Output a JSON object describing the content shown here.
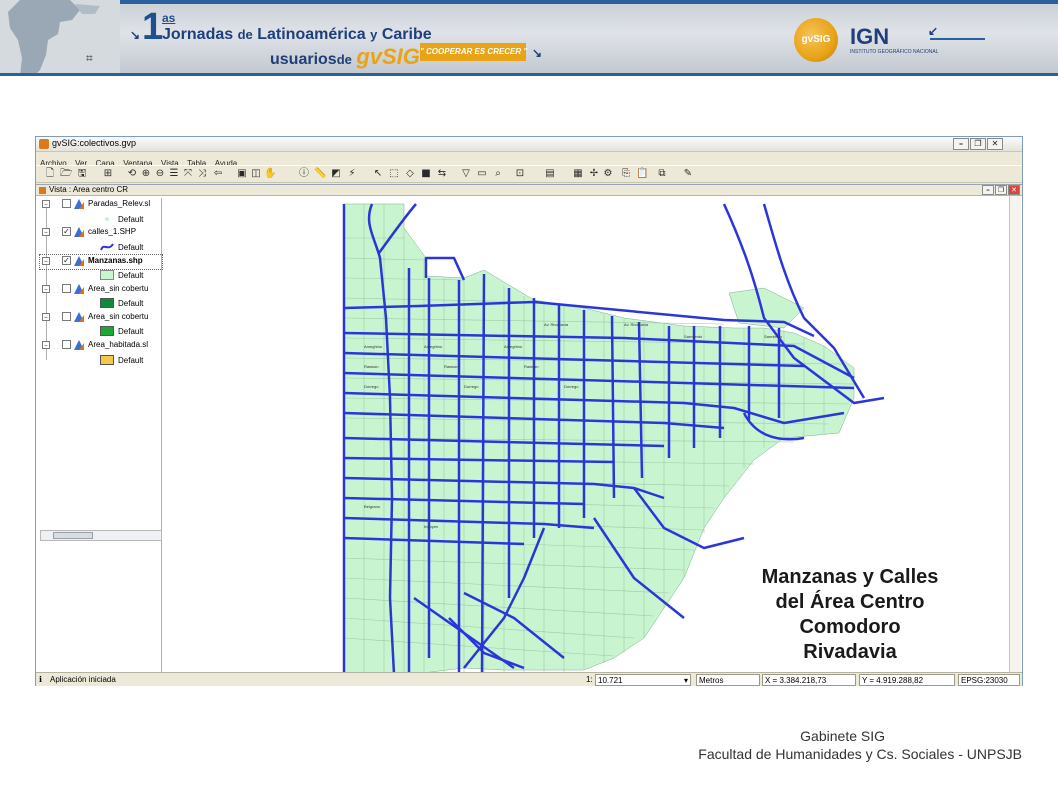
{
  "banner": {
    "number": "1",
    "ordinal": "as",
    "line1_a": "Jornadas",
    "line1_b": "de",
    "line1_c": "Latinoamérica",
    "line1_d": "y",
    "line1_e": "Caribe",
    "line2_a": "usuarios",
    "line2_b": "de",
    "line2_brand": "gvSIG",
    "slogan": "\" COOPERAR ES CRECER \"",
    "logo_gv": "gvSIG",
    "logo_ign": "IGN",
    "logo_ign_sub": "INSTITUTO GEOGRÁFICO NACIONAL"
  },
  "window": {
    "title": "gvSIG:colectivos.gvp",
    "menu": [
      "Archivo",
      "Ver",
      "Capa",
      "Ventana",
      "Vista",
      "Tabla",
      "Ayuda"
    ],
    "view_title": "Vista : Area centro CR"
  },
  "toc": {
    "layers": [
      {
        "name": "Paradas_Relev.sl",
        "checked": false,
        "legend": "Default",
        "symbol": "point",
        "color": "#c8f5d0"
      },
      {
        "name": "calles_1.SHP",
        "checked": true,
        "legend": "Default",
        "symbol": "line",
        "color": "#2b36d9"
      },
      {
        "name": "Manzanas.shp",
        "checked": true,
        "legend": "Default",
        "symbol": "fill",
        "color": "#c8f5d0"
      },
      {
        "name": "Area_sin cobertu",
        "checked": false,
        "legend": "Default",
        "symbol": "fill",
        "color": "#0f8a3c"
      },
      {
        "name": "Area_sin cobertu",
        "checked": false,
        "legend": "Default",
        "symbol": "fill",
        "color": "#1ea63a"
      },
      {
        "name": "Area_habitada.sl",
        "checked": false,
        "legend": "Default",
        "symbol": "fill",
        "color": "#f2c94c"
      }
    ]
  },
  "statusbar": {
    "message": "Aplicación iniciada",
    "scale_prefix": "1:",
    "scale_value": "10.721",
    "units": "Metros",
    "x": "X = 3.384.218,73",
    "y": "Y = 4.919.288,82",
    "epsg": "EPSG:23030"
  },
  "overlay": {
    "line1": "Manzanas y Calles",
    "line2": "del Área Centro",
    "line3": "Comodoro",
    "line4": "Rivadavia"
  },
  "footer": {
    "line1": "Gabinete SIG",
    "line2": "Facultad de Humanidades y Cs. Sociales - UNPSJB"
  },
  "colors": {
    "block_fill": "#c8f5d0",
    "street": "#2b36d9",
    "accent": "#2c5f9e",
    "brand": "#e8a317"
  }
}
